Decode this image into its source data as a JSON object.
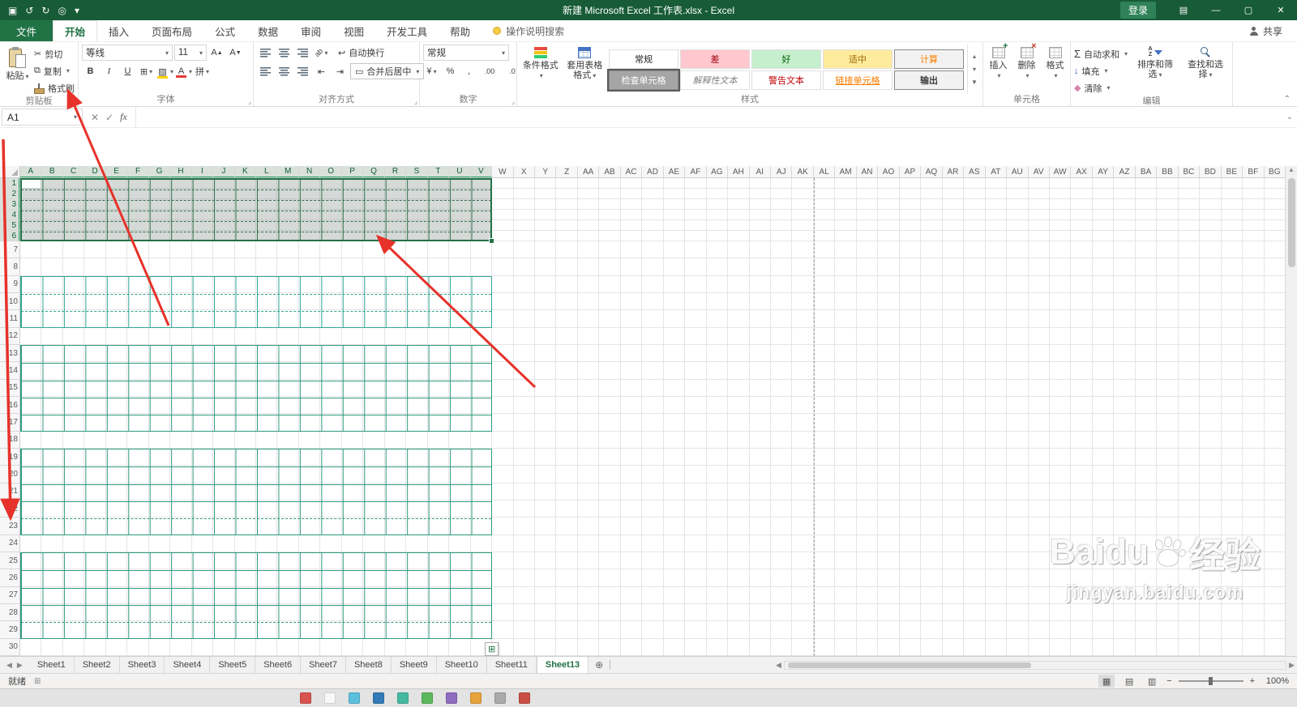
{
  "titlebar": {
    "title": "新建 Microsoft Excel 工作表.xlsx - Excel",
    "login_label": "登录"
  },
  "ribbon_tabs": {
    "file": "文件",
    "tabs": [
      {
        "id": "home",
        "label": "开始",
        "active": true
      },
      {
        "id": "insert",
        "label": "插入"
      },
      {
        "id": "page-layout",
        "label": "页面布局"
      },
      {
        "id": "formulas",
        "label": "公式"
      },
      {
        "id": "data",
        "label": "数据"
      },
      {
        "id": "review",
        "label": "审阅"
      },
      {
        "id": "view",
        "label": "视图"
      },
      {
        "id": "developer",
        "label": "开发工具"
      },
      {
        "id": "help",
        "label": "帮助"
      }
    ],
    "tell_me": "操作说明搜索",
    "share": "共享"
  },
  "clipboard_group": {
    "label": "剪贴板",
    "paste": "粘贴",
    "cut": "剪切",
    "copy": "复制",
    "format_painter": "格式刷"
  },
  "font_group": {
    "label": "字体",
    "font_name": "等线",
    "font_size": "11",
    "bold": "B",
    "italic": "I",
    "underline": "U",
    "phonetic": "拼"
  },
  "alignment_group": {
    "label": "对齐方式",
    "wrap": "自动换行",
    "merge": "合并后居中"
  },
  "number_group": {
    "label": "数字",
    "format": "常规"
  },
  "styles_group": {
    "label": "样式",
    "conditional": "条件格式",
    "format_table": "套用表格格式",
    "gallery": [
      {
        "id": "normal",
        "label": "常规",
        "bg": "#ffffff",
        "color": "#1f1f1f"
      },
      {
        "id": "bad",
        "label": "差",
        "bg": "#ffc7ce",
        "color": "#9c0006"
      },
      {
        "id": "good",
        "label": "好",
        "bg": "#c6efce",
        "color": "#006100"
      },
      {
        "id": "neutral",
        "label": "适中",
        "bg": "#ffeb9c",
        "color": "#9c6500"
      },
      {
        "id": "calculation",
        "label": "计算",
        "bg": "#f2f2f2",
        "color": "#fa7d00",
        "bordered": true
      },
      {
        "id": "check-cell",
        "label": "检查单元格",
        "bg": "#a5a5a5",
        "color": "#ffffff",
        "bordered": true,
        "selected": true
      },
      {
        "id": "explanatory-text",
        "label": "解释性文本",
        "bg": "#ffffff",
        "color": "#808080",
        "italic": true
      },
      {
        "id": "warning-text",
        "label": "警告文本",
        "bg": "#ffffff",
        "color": "#c00000"
      },
      {
        "id": "linked-cell",
        "label": "链接单元格",
        "bg": "#ffffff",
        "color": "#fa7d00",
        "underline": true
      },
      {
        "id": "output",
        "label": "输出",
        "bg": "#f2f2f2",
        "color": "#3f3f3f",
        "bordered": true,
        "bold": true
      }
    ]
  },
  "cells_group": {
    "label": "单元格",
    "insert": "插入",
    "delete": "删除",
    "format": "格式"
  },
  "editing_group": {
    "label": "编辑",
    "autosum": "自动求和",
    "fill": "填充",
    "clear": "清除",
    "sort": "排序和筛选",
    "find": "查找和选择"
  },
  "formula_bar": {
    "name_box": "A1"
  },
  "icons": {
    "save": "▣",
    "undo": "↺",
    "redo": "↻",
    "touch": "◎",
    "caret": "▾",
    "min": "—",
    "max": "▢",
    "close": "✕",
    "ribbon_opts": "▤",
    "cut": "✂",
    "copy": "⧉",
    "borders": "⊞",
    "fill_pattern": "▨",
    "font_a": "A",
    "wrap": "↩",
    "indent_dec": "⇤",
    "indent_ind": "⇥",
    "merge_box": "▭",
    "currency": "¥",
    "percent": "%",
    "comma": ",",
    "inc_dec": ".00",
    "dec_dec": ".0",
    "sigma": "Σ",
    "fill_down": "↓",
    "clear": "◆",
    "sort_arrow": "↓",
    "cancel": "✕",
    "check": "✓",
    "fx": "fx",
    "expand": "⌄",
    "prev": "◀",
    "next": "▶",
    "add_tab": "⊕",
    "dots": "⋮",
    "view_normal": "▦",
    "view_layout": "▤",
    "view_break": "▥",
    "zoom_minus": "−",
    "zoom_plus": "+",
    "corner": "⌟",
    "grid_btn": "⊞",
    "up": "▴",
    "down": "▾",
    "more": "▼",
    "scroll_up": "▲",
    "scroll_down": "▼"
  },
  "grid": {
    "columns": [
      "A",
      "B",
      "C",
      "D",
      "E",
      "F",
      "G",
      "H",
      "I",
      "J",
      "K",
      "L",
      "M",
      "N",
      "O",
      "P",
      "Q",
      "R",
      "S",
      "T",
      "U",
      "V",
      "W",
      "X",
      "Y",
      "Z",
      "AA",
      "AB",
      "AC",
      "AD",
      "AE",
      "AF",
      "AG",
      "AH",
      "AI",
      "AJ",
      "AK",
      "AL",
      "AM",
      "AN",
      "AO",
      "AP",
      "AQ",
      "AR",
      "AS",
      "AT",
      "AU",
      "AV",
      "AW",
      "AX",
      "AY",
      "AZ",
      "BA",
      "BB",
      "BC",
      "BD",
      "BE",
      "BF",
      "BG"
    ],
    "rows": [
      1,
      2,
      3,
      4,
      5,
      6,
      7,
      8,
      9,
      10,
      11,
      12,
      13,
      14,
      15,
      16,
      17,
      18,
      19,
      20,
      21,
      22,
      23,
      24,
      25,
      26,
      27,
      28,
      29,
      30
    ],
    "selection": {
      "range": "A1:V6",
      "col_start": 0,
      "col_end": 21,
      "row_start": 0,
      "row_end": 5
    },
    "page_break_after_col": "AK"
  },
  "pattern_blocks": [
    {
      "rows": [
        1,
        6
      ],
      "style": "four-line",
      "selected": true
    },
    {
      "rows": [
        9,
        11
      ],
      "style": "four-line"
    },
    {
      "rows": [
        13,
        17
      ],
      "style": "grid"
    },
    {
      "rows": [
        19,
        23
      ],
      "style": "grid-dashed-last"
    },
    {
      "rows": [
        25,
        29
      ],
      "style": "grid-dashed-last"
    }
  ],
  "colors": {
    "titlebar_bg": "#185c37",
    "excel_green": "#217346",
    "selection_border": "#217346",
    "pattern_teal": "#31a792",
    "pattern_green": "#2f9b80",
    "arrow_red": "#e6322a"
  },
  "sheet_bar": {
    "tabs": [
      "Sheet1",
      "Sheet2",
      "Sheet3",
      "Sheet4",
      "Sheet5",
      "Sheet6",
      "Sheet7",
      "Sheet8",
      "Sheet9",
      "Sheet10",
      "Sheet11",
      "Sheet13"
    ],
    "active": "Sheet13"
  },
  "status_bar": {
    "ready": "就绪",
    "zoom": "100%"
  },
  "taskbar": {
    "colors": [
      "#d9534f",
      "#f8f8f8",
      "#5bc0de",
      "#337ab7",
      "#46b8a0",
      "#5cb85c",
      "#8e6cc0",
      "#e8a33d",
      "#aaaaaa",
      "#c94f44"
    ]
  },
  "watermark": {
    "brand": "Baidu",
    "brand2": "经验",
    "url": "jingyan.baidu.com"
  }
}
